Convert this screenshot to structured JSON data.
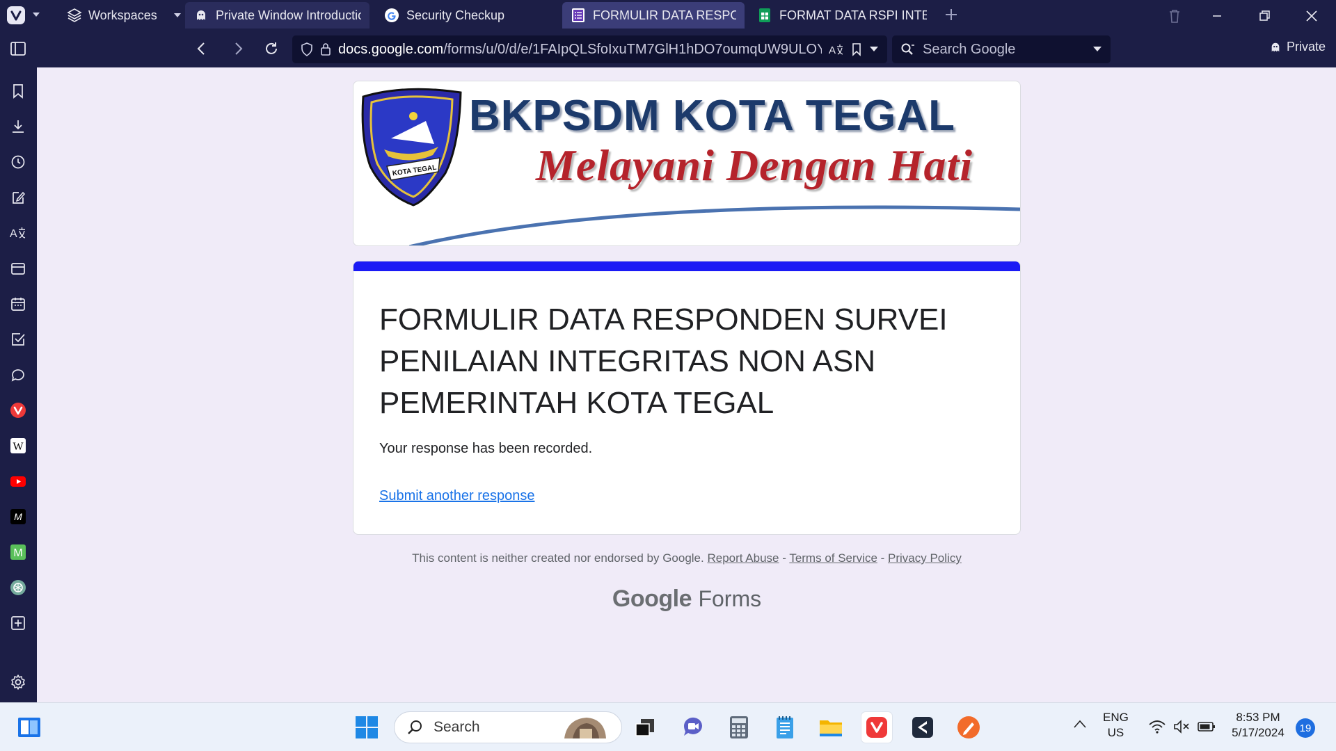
{
  "browser": {
    "workspaces_label": "Workspaces",
    "tabs": [
      {
        "title": "Private Window Introduction",
        "icon": "private-ghost-icon"
      },
      {
        "title": "Security Checkup",
        "icon": "google-g-icon"
      },
      {
        "title": "FORMULIR DATA RESPONDEN",
        "icon": "google-forms-icon",
        "active": true
      },
      {
        "title": "FORMAT DATA RSPI INTERNAL",
        "icon": "google-sheets-icon"
      }
    ],
    "url_domain": "docs.google.com",
    "url_path": "/forms/u/0/d/e/1FAIpQLSfoIxuTM7GlH1hDO7oumqUW9ULOY",
    "search_placeholder": "Search Google",
    "private_label": "Private"
  },
  "sidebar": {
    "icons": [
      "bookmarks-icon",
      "downloads-icon",
      "history-icon",
      "notes-icon",
      "translate-icon",
      "window-panel-icon",
      "calendar-icon",
      "tasks-icon",
      "chat-icon",
      "vivaldi-icon",
      "wikipedia-icon",
      "youtube-icon",
      "mastodon-icon",
      "mail-m-icon",
      "chatgpt-icon",
      "add-panel-icon",
      "settings-icon"
    ]
  },
  "form": {
    "banner_title": "BKPSDM KOTA TEGAL",
    "banner_tagline": "Melayani Dengan Hati",
    "banner_emblem_text": "KOTA TEGAL",
    "accent_color": "#1a1af5",
    "title": "FORMULIR DATA RESPONDEN SURVEI PENILAIAN INTEGRITAS NON ASN PEMERINTAH KOTA TEGAL",
    "confirmation": "Your response has been recorded.",
    "submit_another": "Submit another response"
  },
  "footer": {
    "disclaimer": "This content is neither created nor endorsed by Google.",
    "report_abuse": "Report Abuse",
    "sep1": " - ",
    "terms": "Terms of Service",
    "sep2": " - ",
    "privacy": "Privacy Policy",
    "brand_google": "Google",
    "brand_forms": "Forms"
  },
  "taskbar": {
    "search_label": "Search",
    "lang_1": "ENG",
    "lang_2": "US",
    "time": "8:53 PM",
    "date": "5/17/2024",
    "notification_count": "19"
  }
}
